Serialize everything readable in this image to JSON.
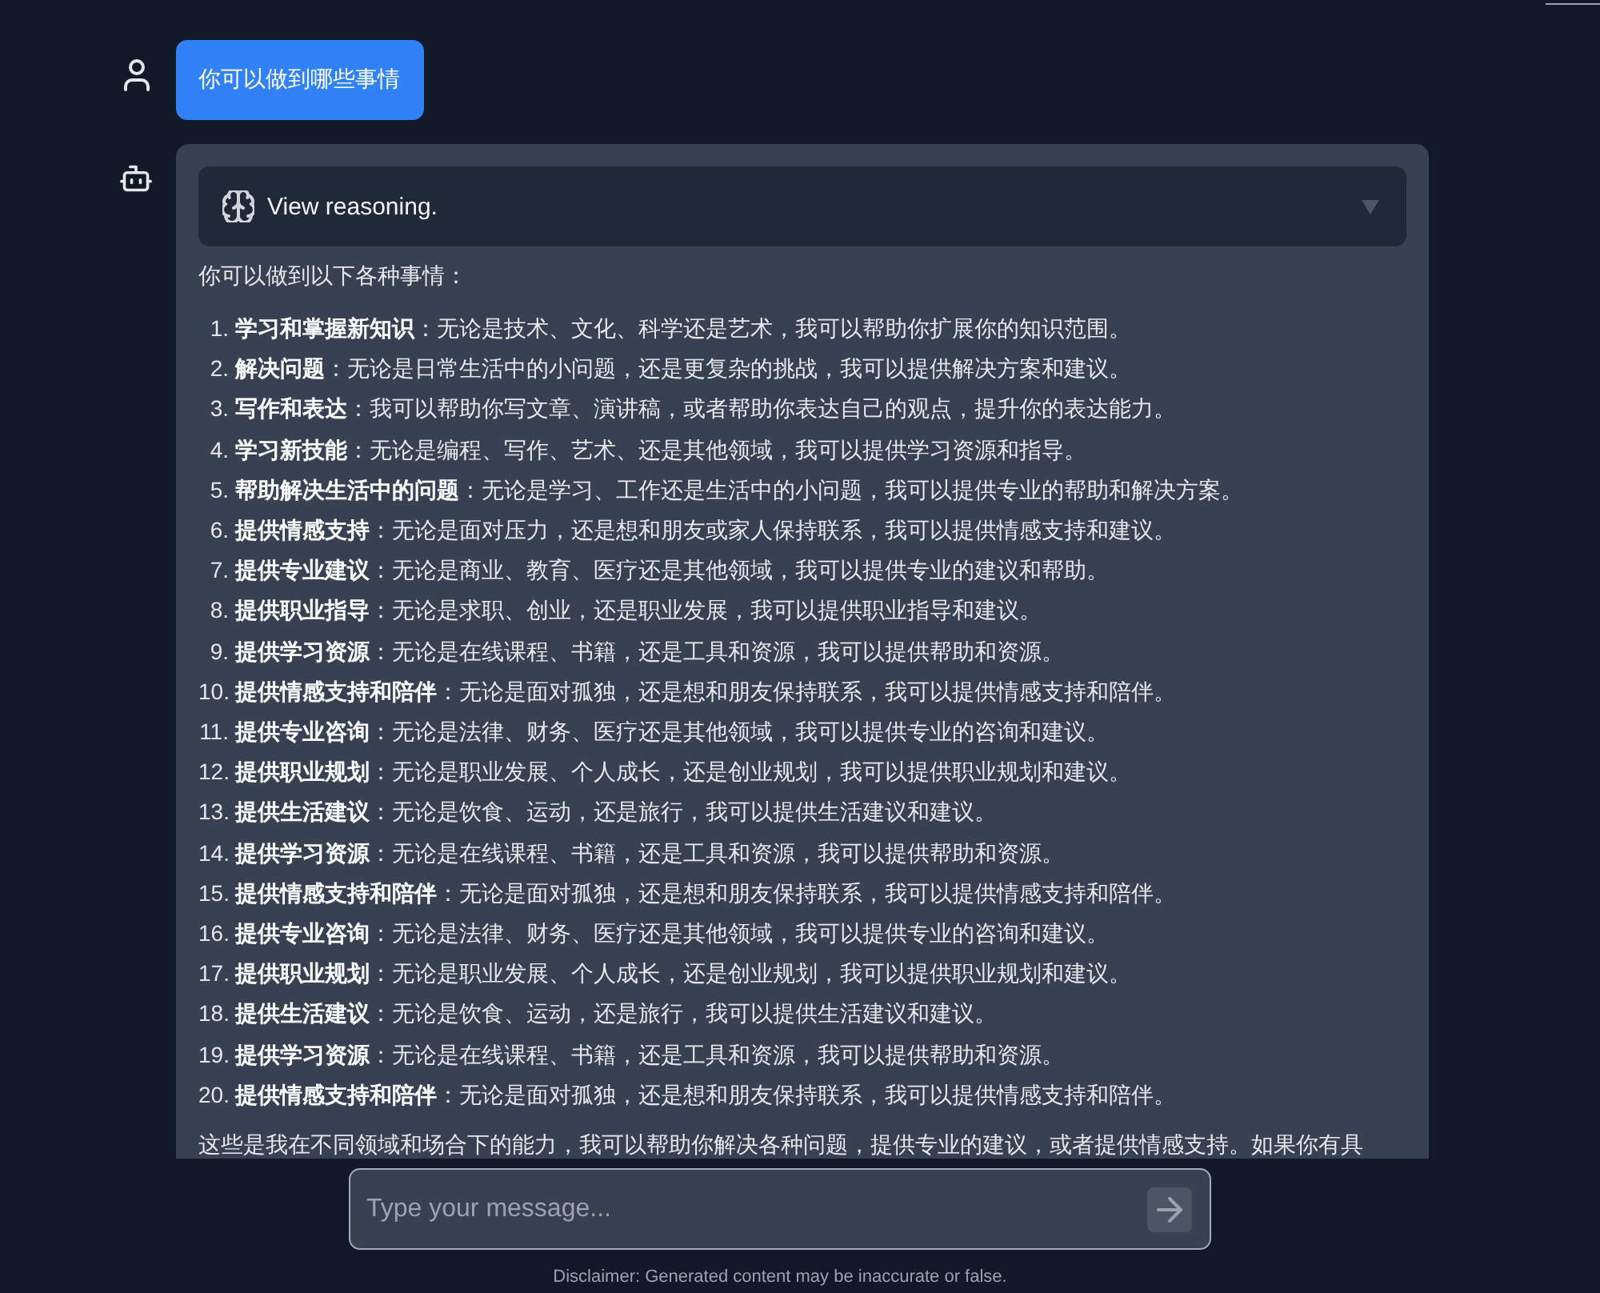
{
  "user_message": {
    "text": "你可以做到哪些事情"
  },
  "assistant_message": {
    "reasoning": {
      "label": "View reasoning.",
      "expanded": false
    },
    "intro": "你可以做到以下各种事情：",
    "items": [
      {
        "number": "1.",
        "text": "**学习和掌握新知识**：无论是技术、文化、科学还是艺术，我可以帮助你扩展你的知识范围。"
      },
      {
        "number": "2.",
        "text": "**解决问题**：无论是日常生活中的小问题，还是更复杂的挑战，我可以提供解决方案和建议。"
      },
      {
        "number": "3.",
        "text": "**写作和表达**：我可以帮助你写文章、演讲稿，或者帮助你表达自己的观点，提升你的表达能力。"
      },
      {
        "number": "4.",
        "text": "**学习新技能**：无论是编程、写作、艺术、还是其他领域，我可以提供学习资源和指导。"
      },
      {
        "number": "5.",
        "text": "**帮助解决生活中的问题**：无论是学习、工作还是生活中的小问题，我可以提供专业的帮助和解决方案。"
      },
      {
        "number": "6.",
        "text": "**提供情感支持**：无论是面对压力，还是想和朋友或家人保持联系，我可以提供情感支持和建议。"
      },
      {
        "number": "7.",
        "text": "**提供专业建议**：无论是商业、教育、医疗还是其他领域，我可以提供专业的建议和帮助。"
      },
      {
        "number": "8.",
        "text": "**提供职业指导**：无论是求职、创业，还是职业发展，我可以提供职业指导和建议。"
      },
      {
        "number": "9.",
        "text": "**提供学习资源**：无论是在线课程、书籍，还是工具和资源，我可以提供帮助和资源。"
      },
      {
        "number": "10.",
        "text": "**提供情感支持和陪伴**：无论是面对孤独，还是想和朋友保持联系，我可以提供情感支持和陪伴。"
      },
      {
        "number": "11.",
        "text": "**提供专业咨询**：无论是法律、财务、医疗还是其他领域，我可以提供专业的咨询和建议。"
      },
      {
        "number": "12.",
        "text": "**提供职业规划**：无论是职业发展、个人成长，还是创业规划，我可以提供职业规划和建议。"
      },
      {
        "number": "13.",
        "text": "**提供生活建议**：无论是饮食、运动，还是旅行，我可以提供生活建议和建议。"
      },
      {
        "number": "14.",
        "text": "**提供学习资源**：无论是在线课程、书籍，还是工具和资源，我可以提供帮助和资源。"
      },
      {
        "number": "15.",
        "text": "**提供情感支持和陪伴**：无论是面对孤独，还是想和朋友保持联系，我可以提供情感支持和陪伴。"
      },
      {
        "number": "16.",
        "text": "**提供专业咨询**：无论是法律、财务、医疗还是其他领域，我可以提供专业的咨询和建议。"
      },
      {
        "number": "17.",
        "text": "**提供职业规划**：无论是职业发展、个人成长，还是创业规划，我可以提供职业规划和建议。"
      },
      {
        "number": "18.",
        "text": "**提供生活建议**：无论是饮食、运动，还是旅行，我可以提供生活建议和建议。"
      },
      {
        "number": "19.",
        "text": "**提供学习资源**：无论是在线课程、书籍，还是工具和资源，我可以提供帮助和资源。"
      },
      {
        "number": "20.",
        "text": "**提供情感支持和陪伴**：无论是面对孤独，还是想和朋友保持联系，我可以提供情感支持和陪伴。"
      }
    ],
    "closing": "这些是我在不同领域和场合下的能力，我可以帮助你解决各种问题，提供专业的建议，或者提供情感支持。如果你有具"
  },
  "composer": {
    "placeholder": "Type your message..."
  },
  "disclaimer": "Disclaimer: Generated content may be inaccurate or false."
}
